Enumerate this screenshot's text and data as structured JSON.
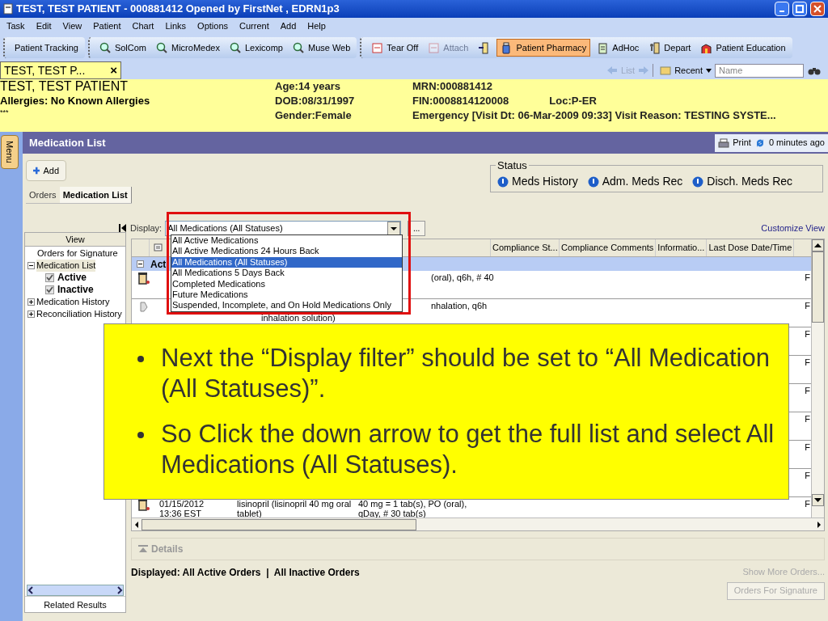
{
  "window": {
    "title": "TEST, TEST PATIENT - 000881412 Opened by FirstNet , EDRN1p3"
  },
  "menu_bar": [
    "Task",
    "Edit",
    "View",
    "Patient",
    "Chart",
    "Links",
    "Options",
    "Current",
    "Add",
    "Help"
  ],
  "toolbar_groups": [
    {
      "items": [
        {
          "label": "Patient Tracking",
          "kind": "plain",
          "disabled": false,
          "selected": false
        }
      ]
    },
    {
      "items": [
        {
          "label": "SolCom",
          "kind": "search",
          "disabled": false,
          "selected": false
        },
        {
          "label": "MicroMedex",
          "kind": "search",
          "disabled": false,
          "selected": false
        },
        {
          "label": "Lexicomp",
          "kind": "search",
          "disabled": false,
          "selected": false
        },
        {
          "label": "Muse Web",
          "kind": "search",
          "disabled": false,
          "selected": false
        }
      ]
    },
    {
      "items": [
        {
          "label": "Tear Off",
          "kind": "tear",
          "disabled": false,
          "selected": false
        },
        {
          "label": "Attach",
          "kind": "tear",
          "disabled": true,
          "selected": false
        },
        {
          "kind": "exit",
          "disabled": false,
          "selected": false
        },
        {
          "label": "Patient Pharmacy",
          "kind": "pharmacy",
          "disabled": false,
          "selected": true
        },
        {
          "label": "AdHoc",
          "kind": "adhoc",
          "disabled": false,
          "selected": false
        },
        {
          "label": "Depart",
          "kind": "depart",
          "disabled": false,
          "selected": false
        },
        {
          "label": "Patient Education",
          "kind": "education",
          "disabled": false,
          "selected": false
        }
      ]
    }
  ],
  "patient_tab": {
    "label": "TEST, TEST P...",
    "close": "×"
  },
  "nav": {
    "list": "List",
    "recent": "Recent",
    "search_placeholder": "Name"
  },
  "banner": {
    "name": "TEST, TEST PATIENT",
    "allergies": "Allergies: No Known Allergies",
    "note": "***",
    "age": "Age:14 years",
    "dob": "DOB:08/31/1997",
    "gender": "Gender:Female",
    "mrn": "MRN:000881412",
    "fin": "FIN:0008814120008",
    "loc": "Loc:P-ER",
    "visit": "Emergency [Visit Dt: 06-Mar-2009 09:33] Visit Reason: TESTING SYSTE..."
  },
  "side_tab": "Menu",
  "section": {
    "title": "Medication List",
    "print": "Print",
    "refresh": "0 minutes ago"
  },
  "add_button": "Add",
  "status": {
    "title": "Status",
    "items": [
      "Meds History",
      "Adm. Meds Rec",
      "Disch. Meds Rec"
    ]
  },
  "tabs": [
    {
      "label": "Orders",
      "selected": false
    },
    {
      "label": "Medication List",
      "selected": true
    }
  ],
  "display": {
    "label": "Display:",
    "value": "All Medications (All Statuses)",
    "more": "...",
    "customize": "Customize View",
    "options": [
      {
        "label": "All Active Medications",
        "selected": false
      },
      {
        "label": "All Active Medications 24 Hours Back",
        "selected": false
      },
      {
        "label": "All Medications (All Statuses)",
        "selected": true
      },
      {
        "label": "All Medications 5 Days Back",
        "selected": false
      },
      {
        "label": "Completed Medications",
        "selected": false
      },
      {
        "label": "Future Medications",
        "selected": false
      },
      {
        "label": "Suspended, Incomplete, and On Hold Medications Only",
        "selected": false
      }
    ]
  },
  "view_panel": {
    "title": "View",
    "tree": [
      {
        "label": "Orders for Signature",
        "selected": false
      },
      {
        "label": "Medication List",
        "selected": true,
        "expanded": true,
        "children": [
          {
            "label": "Active",
            "checked": true
          },
          {
            "label": "Inactive",
            "checked": true
          }
        ]
      },
      {
        "label": "Medication History",
        "selected": false,
        "expanded": false
      },
      {
        "label": "Reconciliation History",
        "selected": false,
        "expanded": false
      }
    ],
    "footer": "Related Results"
  },
  "table": {
    "columns": [
      "Compliance St...",
      "Compliance Comments",
      "Informatio...",
      "Last Dose Date/Time"
    ],
    "group": "Act",
    "rows": [
      {
        "kind": "pill",
        "dose": "(oral), q6h, # 40",
        "last": "F"
      },
      {
        "kind": "inhaler",
        "name2": "inhalation solution)",
        "dose": "nhalation, q6h",
        "last": "F"
      },
      {
        "kind": "hidden",
        "last": "F"
      },
      {
        "kind": "hidden",
        "last": "F"
      },
      {
        "kind": "hidden",
        "last": "F"
      },
      {
        "kind": "hidden",
        "last": "F"
      },
      {
        "kind": "hidden",
        "last": "F"
      },
      {
        "kind": "hidden",
        "last": "F"
      },
      {
        "kind": "pill",
        "date": "01/15/2012",
        "time": "13:36 EST",
        "name": "lisinopril (lisinopril 40 mg oral",
        "name2": "tablet)",
        "dose": "40 mg = 1 tab(s), PO (oral),",
        "dose2": "qDay, # 30 tab(s)",
        "last": "F"
      }
    ]
  },
  "details": "Details",
  "footer": {
    "displayed": "Displayed: All Active Orders  |  All Inactive Orders",
    "show_more": "Show More Orders...",
    "sign": "Orders For Signature"
  },
  "callout": [
    "Next the “Display  filter” should be set  to “All Medication (All Statuses)”.",
    "So Click the down arrow to get the full list and select All Medications (All Statuses)."
  ]
}
